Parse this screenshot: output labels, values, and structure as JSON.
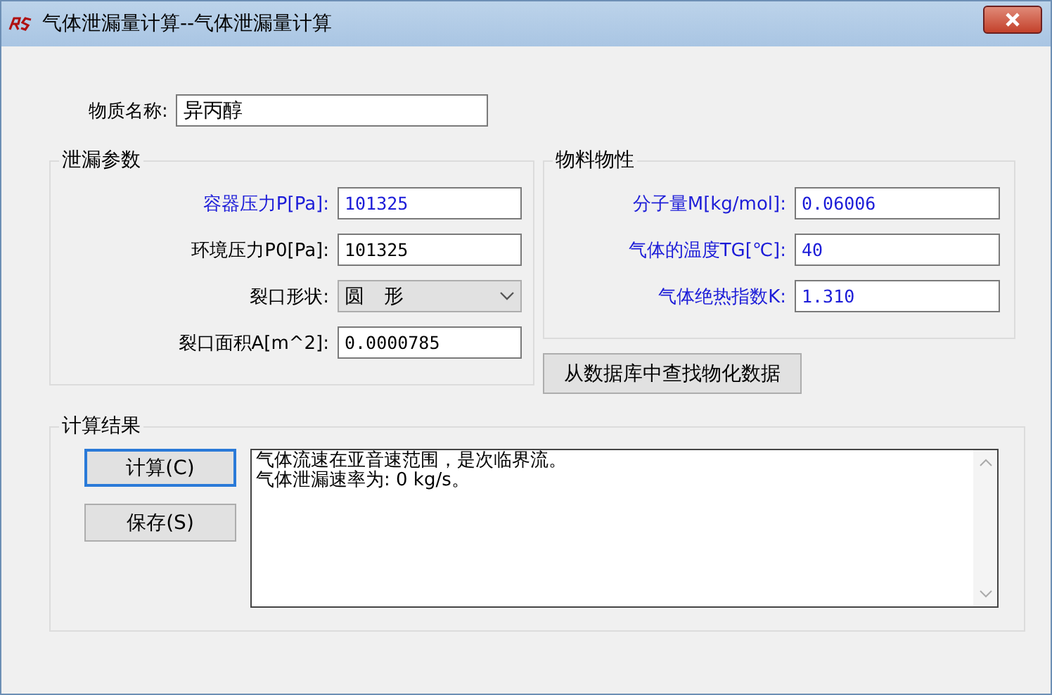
{
  "window": {
    "title": "气体泄漏量计算--气体泄漏量计算"
  },
  "substance": {
    "label": "物质名称:",
    "value": "异丙醇"
  },
  "leak_params": {
    "title": "泄漏参数",
    "fields": [
      {
        "kind": "input",
        "label": "容器压力P[Pa]:",
        "value": "101325",
        "highlighted": true
      },
      {
        "kind": "input",
        "label": "环境压力P0[Pa]:",
        "value": "101325",
        "highlighted": false
      },
      {
        "kind": "select",
        "label": "裂口形状:",
        "value": "圆　形",
        "highlighted": false
      },
      {
        "kind": "input",
        "label": "裂口面积A[m^2]:",
        "value": "0.0000785",
        "highlighted": false
      }
    ]
  },
  "properties": {
    "title": "物料物性",
    "fields": [
      {
        "kind": "input",
        "label": "分子量M[kg/mol]:",
        "value": "0.06006",
        "highlighted": true
      },
      {
        "kind": "input",
        "label": "气体的温度TG[℃]:",
        "value": "40",
        "highlighted": true
      },
      {
        "kind": "input",
        "label": "气体绝热指数K:",
        "value": "1.310",
        "highlighted": true
      }
    ]
  },
  "lookup_button": "从数据库中查找物化数据",
  "results": {
    "title": "计算结果",
    "buttons": [
      {
        "label": "计算(C)",
        "focused": true
      },
      {
        "label": "保存(S)",
        "focused": false
      }
    ],
    "lines": [
      "气体流速在亚音速范围，是次临界流。",
      "气体泄漏速率为: 0 kg/s。"
    ]
  }
}
